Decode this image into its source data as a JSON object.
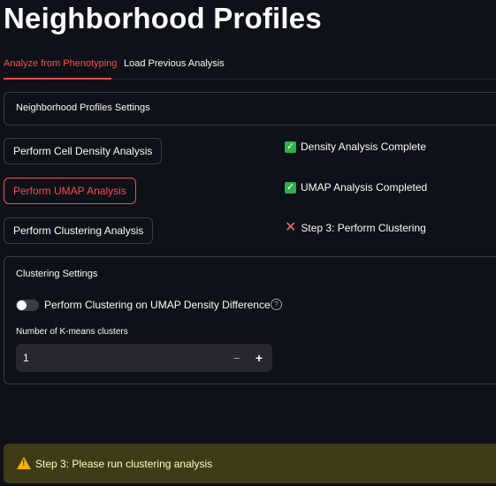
{
  "page": {
    "title": "Neighborhood Profiles"
  },
  "tabs": [
    {
      "label": "Analyze from Phenotyping",
      "active": true
    },
    {
      "label": "Load Previous Analysis",
      "active": false
    }
  ],
  "settings_expander": {
    "label": "Neighborhood Profiles Settings"
  },
  "actions": {
    "density_button": "Perform Cell Density Analysis",
    "umap_button": "Perform UMAP Analysis",
    "clustering_button": "Perform Clustering Analysis"
  },
  "statuses": [
    {
      "text": "Density Analysis Complete",
      "state": "done"
    },
    {
      "text": "UMAP Analysis Completed",
      "state": "done"
    },
    {
      "text": "Step 3: Perform Clustering",
      "state": "pending"
    }
  ],
  "clustering": {
    "title": "Clustering Settings",
    "toggle_label": "Perform Clustering on UMAP Density Difference",
    "toggle_on": false,
    "kmeans_label": "Number of K-means clusters",
    "kmeans_value": "1",
    "minus": "−",
    "plus": "+"
  },
  "warning": {
    "text": "Step 3: Please run clustering analysis"
  },
  "colors": {
    "accent": "#ff4b4b",
    "success": "#2fb04a",
    "warning_bg": "#3e3b16"
  }
}
